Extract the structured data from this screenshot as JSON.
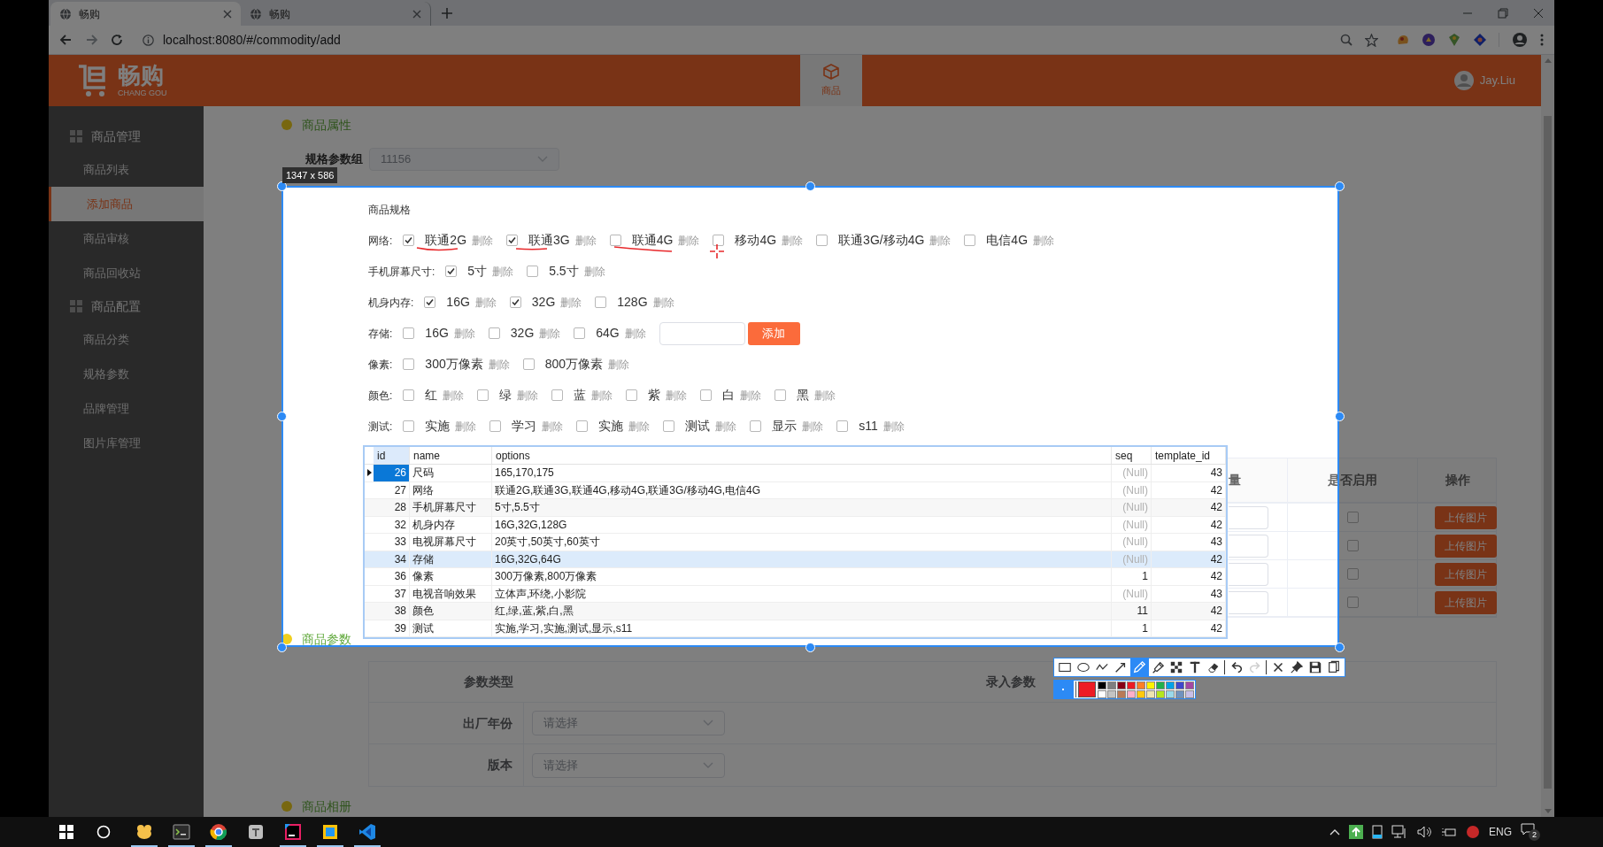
{
  "browser": {
    "tabs": [
      {
        "title": "畅购",
        "selected": true
      },
      {
        "title": "畅购",
        "selected": false
      }
    ],
    "url": "localhost:8080/#/commodity/add"
  },
  "header": {
    "logo": "畅购",
    "logo_subtitle": "CHANG GOU",
    "nav": [
      {
        "label": "商品",
        "selected": true
      }
    ],
    "user": "Jay.Liu"
  },
  "sidebar": {
    "groups": [
      {
        "label": "商品管理",
        "children": [
          {
            "label": "商品列表",
            "selected": false
          },
          {
            "label": "添加商品",
            "selected": true
          },
          {
            "label": "商品审核",
            "selected": false
          },
          {
            "label": "商品回收站",
            "selected": false
          }
        ]
      },
      {
        "label": "商品配置",
        "children": [
          {
            "label": "商品分类",
            "selected": false
          },
          {
            "label": "规格参数",
            "selected": false
          },
          {
            "label": "品牌管理",
            "selected": false
          },
          {
            "label": "图片库管理",
            "selected": false
          }
        ]
      }
    ]
  },
  "attributes": {
    "title": "商品属性",
    "spec_group": {
      "label": "规格参数组",
      "value": "11156"
    },
    "spec_title": "商品规格",
    "specs": [
      {
        "label": "网络:",
        "options": [
          {
            "label": "联通2G",
            "checked": true,
            "action": "删除"
          },
          {
            "label": "联通3G",
            "checked": true,
            "action": "删除"
          },
          {
            "label": "联通4G",
            "checked": false,
            "action": "删除"
          },
          {
            "label": "移动4G",
            "checked": false,
            "action": "删除"
          },
          {
            "label": "联通3G/移动4G",
            "checked": false,
            "action": "删除"
          },
          {
            "label": "电信4G",
            "checked": false,
            "action": "删除"
          }
        ]
      },
      {
        "label": "手机屏幕尺寸:",
        "options": [
          {
            "label": "5寸",
            "checked": true,
            "action": "删除"
          },
          {
            "label": "5.5寸",
            "checked": false,
            "action": "删除"
          }
        ]
      },
      {
        "label": "机身内存:",
        "options": [
          {
            "label": "16G",
            "checked": true,
            "action": "删除"
          },
          {
            "label": "32G",
            "checked": true,
            "action": "删除"
          },
          {
            "label": "128G",
            "checked": false,
            "action": "删除"
          }
        ]
      },
      {
        "label": "存储:",
        "options": [
          {
            "label": "16G",
            "checked": false,
            "action": "删除"
          },
          {
            "label": "32G",
            "checked": false,
            "action": "删除"
          },
          {
            "label": "64G",
            "checked": false,
            "action": "删除"
          }
        ],
        "new_option": {
          "button": "添加"
        }
      },
      {
        "label": "像素:",
        "options": [
          {
            "label": "300万像素",
            "checked": false,
            "action": "删除"
          },
          {
            "label": "800万像素",
            "checked": false,
            "action": "删除"
          }
        ]
      },
      {
        "label": "颜色:",
        "options": [
          {
            "label": "红",
            "checked": false,
            "action": "删除"
          },
          {
            "label": "绿",
            "checked": false,
            "action": "删除"
          },
          {
            "label": "蓝",
            "checked": false,
            "action": "删除"
          },
          {
            "label": "紫",
            "checked": false,
            "action": "删除"
          },
          {
            "label": "白",
            "checked": false,
            "action": "删除"
          },
          {
            "label": "黑",
            "checked": false,
            "action": "删除"
          }
        ]
      },
      {
        "label": "测试:",
        "options": [
          {
            "label": "实施",
            "checked": false,
            "action": "删除"
          },
          {
            "label": "学习",
            "checked": false,
            "action": "删除"
          },
          {
            "label": "实施",
            "checked": false,
            "action": "删除"
          },
          {
            "label": "测试",
            "checked": false,
            "action": "删除"
          },
          {
            "label": "显示",
            "checked": false,
            "action": "删除"
          },
          {
            "label": "s11",
            "checked": false,
            "action": "删除"
          }
        ]
      }
    ]
  },
  "sku_table": {
    "columns": [
      "量",
      "是否启用",
      "操作"
    ],
    "rows": [
      {
        "enabled": false,
        "action": "上传图片"
      },
      {
        "enabled": false,
        "action": "上传图片"
      },
      {
        "enabled": false,
        "action": "上传图片"
      },
      {
        "enabled": false,
        "action": "上传图片"
      }
    ]
  },
  "params": {
    "title": "商品参数",
    "columns": [
      "参数类型",
      "录入参数"
    ],
    "rows": [
      {
        "label": "出厂年份",
        "placeholder": "请选择"
      },
      {
        "label": "版本",
        "placeholder": "请选择"
      }
    ]
  },
  "gallery": {
    "title": "商品相册"
  },
  "capture": {
    "size": "1347 x 586",
    "tools": [
      [
        {
          "kind": "rectangle",
          "selected": false,
          "disabled": false
        },
        {
          "kind": "ellipse",
          "selected": false,
          "disabled": false
        },
        {
          "kind": "polyline",
          "selected": false,
          "disabled": false
        },
        {
          "kind": "arrow",
          "selected": false,
          "disabled": false
        },
        {
          "kind": "pencil",
          "selected": true,
          "disabled": false
        },
        {
          "kind": "marker",
          "selected": false,
          "disabled": false
        },
        {
          "kind": "mosaic",
          "selected": false,
          "disabled": false
        },
        {
          "kind": "text",
          "selected": false,
          "disabled": false
        },
        {
          "kind": "eraser",
          "selected": false,
          "disabled": false
        }
      ],
      [
        {
          "kind": "undo",
          "selected": false,
          "disabled": false
        },
        {
          "kind": "redo",
          "selected": false,
          "disabled": true
        }
      ],
      [
        {
          "kind": "close",
          "selected": false,
          "disabled": false
        },
        {
          "kind": "pin",
          "selected": false,
          "disabled": false
        },
        {
          "kind": "save",
          "selected": false,
          "disabled": false
        },
        {
          "kind": "copy",
          "selected": false,
          "disabled": false
        }
      ]
    ],
    "current": {
      "color": "#ed1c24"
    },
    "colors": [
      {
        "color": "#000000"
      },
      {
        "color": "#7f7f7f"
      },
      {
        "color": "#880015"
      },
      {
        "color": "#ed1c24"
      },
      {
        "color": "#ff7f27"
      },
      {
        "color": "#fff200"
      },
      {
        "color": "#22b14c"
      },
      {
        "color": "#00a2e8"
      },
      {
        "color": "#3f48cc"
      },
      {
        "color": "#a349a4"
      },
      {
        "color": "#ffffff"
      },
      {
        "color": "#c3c3c3"
      },
      {
        "color": "#b97a57"
      },
      {
        "color": "#ffaec9"
      },
      {
        "color": "#ffc90e"
      },
      {
        "color": "#efe4b0"
      },
      {
        "color": "#b5e61d"
      },
      {
        "color": "#99d9ea"
      },
      {
        "color": "#7092be"
      },
      {
        "color": "#c8bfe7"
      }
    ]
  },
  "db_table": {
    "columns": [
      "id",
      "name",
      "options",
      "seq",
      "template_id"
    ],
    "rows": [
      {
        "id": "26",
        "name": "尺码",
        "options": "165,170,175",
        "seq": {
          "text": "(Null)",
          "null": true
        },
        "template_id": "43",
        "selected": true,
        "hovered": false
      },
      {
        "id": "27",
        "name": "网络",
        "options": "联通2G,联通3G,联通4G,移动4G,联通3G/移动4G,电信4G",
        "seq": {
          "text": "(Null)",
          "null": true
        },
        "template_id": "42",
        "selected": false,
        "hovered": false
      },
      {
        "id": "28",
        "name": "手机屏幕尺寸",
        "options": "5寸,5.5寸",
        "seq": {
          "text": "(Null)",
          "null": true
        },
        "template_id": "42",
        "selected": false,
        "hovered": false
      },
      {
        "id": "32",
        "name": "机身内存",
        "options": "16G,32G,128G",
        "seq": {
          "text": "(Null)",
          "null": true
        },
        "template_id": "42",
        "selected": false,
        "hovered": false
      },
      {
        "id": "33",
        "name": "电视屏幕尺寸",
        "options": "20英寸,50英寸,60英寸",
        "seq": {
          "text": "(Null)",
          "null": true
        },
        "template_id": "43",
        "selected": false,
        "hovered": false
      },
      {
        "id": "34",
        "name": "存储",
        "options": "16G,32G,64G",
        "seq": {
          "text": "(Null)",
          "null": true
        },
        "template_id": "42",
        "selected": false,
        "hovered": true
      },
      {
        "id": "36",
        "name": "像素",
        "options": "300万像素,800万像素",
        "seq": {
          "text": "1",
          "null": false
        },
        "template_id": "42",
        "selected": false,
        "hovered": false
      },
      {
        "id": "37",
        "name": "电视音响效果",
        "options": "立体声,环绕,小影院",
        "seq": {
          "text": "(Null)",
          "null": true
        },
        "template_id": "43",
        "selected": false,
        "hovered": false
      },
      {
        "id": "38",
        "name": "颜色",
        "options": "红,绿,蓝,紫,白,黑",
        "seq": {
          "text": "11",
          "null": false
        },
        "template_id": "42",
        "selected": false,
        "hovered": false
      },
      {
        "id": "39",
        "name": "测试",
        "options": "实施,学习,实施,测试,显示,s11",
        "seq": {
          "text": "1",
          "null": false
        },
        "template_id": "42",
        "selected": false,
        "hovered": false
      }
    ]
  },
  "taskbar": {
    "apps": [
      {
        "kind": "duck",
        "running": true
      },
      {
        "kind": "terminal",
        "running": true
      },
      {
        "kind": "browser",
        "running": true
      },
      {
        "kind": "document",
        "running": false
      },
      {
        "kind": "ide",
        "running": true
      },
      {
        "kind": "squares",
        "running": true
      },
      {
        "kind": "editor",
        "running": true
      }
    ],
    "language": "ENG",
    "notifications": "2"
  }
}
